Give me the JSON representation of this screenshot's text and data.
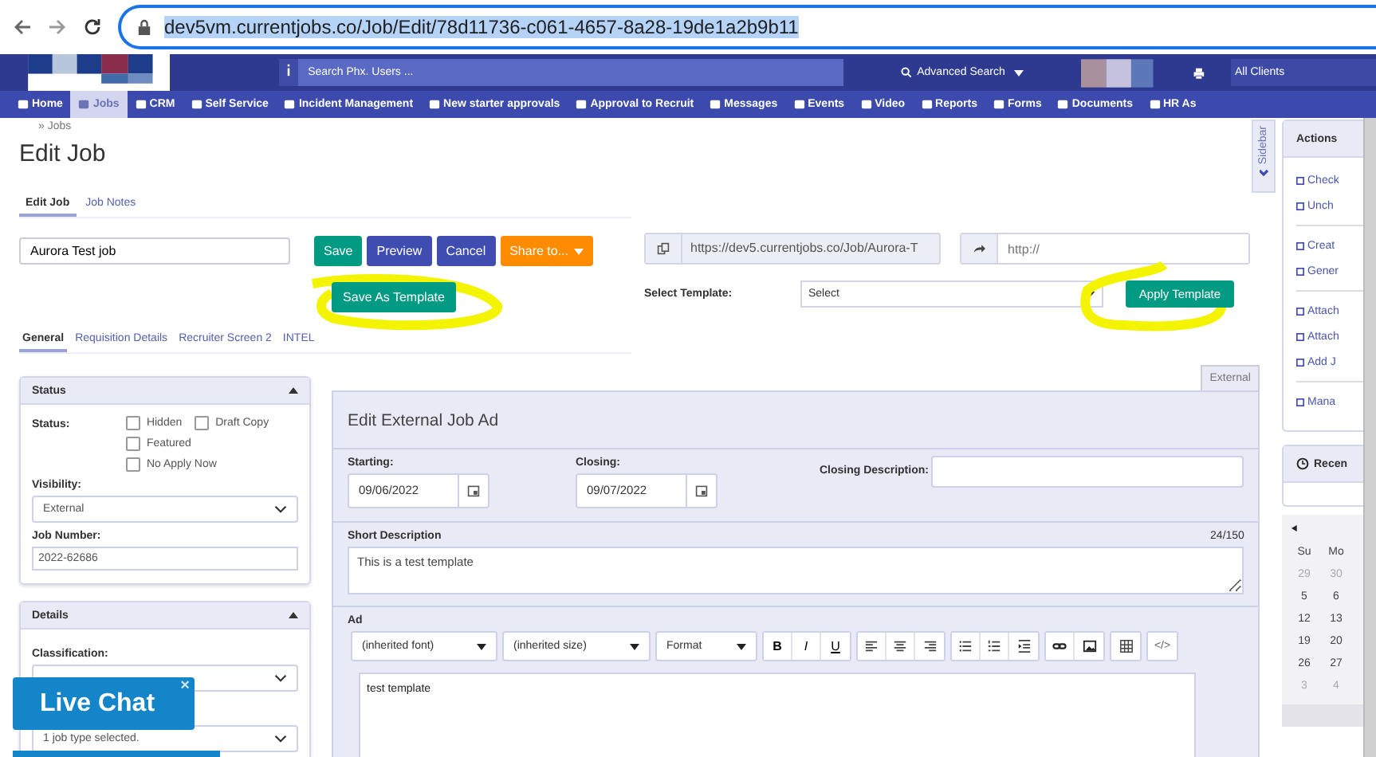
{
  "browser": {
    "url": "dev5vm.currentjobs.co/Job/Edit/78d11736-c061-4657-8a28-19de1a2b9b11"
  },
  "header": {
    "search_placeholder": "Search Phx. Users ...",
    "advanced_search": "Advanced Search",
    "client": "All Clients"
  },
  "nav": [
    {
      "label": "Home",
      "selected": false
    },
    {
      "label": "Jobs",
      "selected": true
    },
    {
      "label": "CRM",
      "selected": false
    },
    {
      "label": "Self Service",
      "selected": false
    },
    {
      "label": "Incident Management",
      "selected": false
    },
    {
      "label": "New starter approvals",
      "selected": false
    },
    {
      "label": "Approval to Recruit",
      "selected": false
    },
    {
      "label": "Messages",
      "selected": false
    },
    {
      "label": "Events",
      "selected": false
    },
    {
      "label": "Video",
      "selected": false
    },
    {
      "label": "Reports",
      "selected": false
    },
    {
      "label": "Forms",
      "selected": false
    },
    {
      "label": "Documents",
      "selected": false
    },
    {
      "label": "HR As",
      "selected": false
    }
  ],
  "breadcrumb": {
    "separator": "»",
    "label": "Jobs"
  },
  "title": "Edit Job",
  "tabs": [
    {
      "label": "Edit Job",
      "selected": true
    },
    {
      "label": "Job Notes",
      "selected": false
    }
  ],
  "job_name": "Aurora Test job",
  "buttons": [
    {
      "label": "Save",
      "kind": "green"
    },
    {
      "label": "Preview",
      "kind": "blue"
    },
    {
      "label": "Cancel",
      "kind": "blue"
    },
    {
      "label": "Share to...",
      "kind": "orange"
    }
  ],
  "save_as_template": "Save As Template",
  "public_url": "https://dev5.currentjobs.co/Job/Aurora-T",
  "redirect_placeholder": "http://",
  "template": {
    "label": "Select Template:",
    "value": "Select",
    "button": "Apply Template"
  },
  "section_tabs": [
    {
      "label": "General",
      "selected": true
    },
    {
      "label": "Requisition Details",
      "selected": false
    },
    {
      "label": "Recruiter Screen 2",
      "selected": false
    },
    {
      "label": "INTEL",
      "selected": false
    }
  ],
  "status_panel": {
    "title": "Status",
    "status_label": "Status:",
    "checkboxes": [
      {
        "label": "Hidden",
        "checked": false
      },
      {
        "label": "Draft Copy",
        "checked": false
      },
      {
        "label": "Featured",
        "checked": false
      },
      {
        "label": "No Apply Now",
        "checked": false
      }
    ],
    "visibility_label": "Visibility:",
    "visibility": "External",
    "job_number_label": "Job Number:",
    "job_number": "2022-62686"
  },
  "details_panel": {
    "title": "Details",
    "classification_label": "Classification:",
    "job_type": "1 job type selected."
  },
  "ad_tabs": [
    {
      "label": "External",
      "selected": true
    }
  ],
  "ad_panel": {
    "title": "Edit External Job Ad",
    "starting_label": "Starting:",
    "starting": "09/06/2022",
    "closing_label": "Closing:",
    "closing": "09/07/2022",
    "closing_description_label": "Closing Description:",
    "short_description_label": "Short Description",
    "counter": "24/150",
    "short_description": "This is a test template",
    "ad_label": "Ad",
    "dropdowns": [
      "(inherited font)",
      "(inherited size)",
      "Format"
    ],
    "format_buttons": [
      "B",
      "I",
      "U"
    ],
    "code_button": "</>",
    "content": "test template"
  },
  "sidebar_tab": "Sidebar",
  "actions": {
    "title": "Actions",
    "items": [
      "Check",
      "Unch",
      "Creat",
      "Gener",
      "Attach",
      "Attach",
      "Add J",
      "Mana"
    ]
  },
  "recent": {
    "title": "Recen"
  },
  "calendar": {
    "weekdays": [
      "Su",
      "Mo"
    ],
    "days": [
      {
        "label": "29",
        "muted": true
      },
      {
        "label": "30",
        "muted": true
      },
      {
        "label": "5",
        "muted": false
      },
      {
        "label": "6",
        "muted": false
      },
      {
        "label": "12",
        "muted": false
      },
      {
        "label": "13",
        "muted": false
      },
      {
        "label": "19",
        "muted": false
      },
      {
        "label": "20",
        "muted": false
      },
      {
        "label": "26",
        "muted": false
      },
      {
        "label": "27",
        "muted": false
      },
      {
        "label": "3",
        "muted": true
      },
      {
        "label": "4",
        "muted": true
      }
    ]
  },
  "live_chat": {
    "label": "Live Chat",
    "close": "×"
  }
}
